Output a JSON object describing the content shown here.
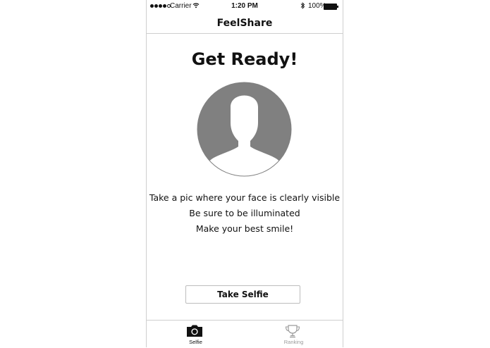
{
  "status_bar": {
    "carrier": "Carrier",
    "time": "1:20 PM",
    "battery": "100%",
    "wifi_icon": "wifi-icon",
    "bluetooth_icon": "bluetooth-icon"
  },
  "nav": {
    "title": "FeelShare"
  },
  "main": {
    "headline": "Get Ready!",
    "avatar_icon": "person-silhouette-icon",
    "instructions": [
      "Take  a pic  where your  face is clearly visible",
      "Be sure to be illuminated",
      "Make your best smile!"
    ],
    "take_selfie_label": "Take Selfie"
  },
  "tab_bar": {
    "tabs": [
      {
        "label": "Selfie",
        "icon": "camera-icon",
        "active": true
      },
      {
        "label": "Ranking",
        "icon": "trophy-icon",
        "active": false
      }
    ]
  },
  "colors": {
    "avatar_gray": "#808080",
    "border": "#cfcfcf",
    "inactive_tab": "#9a9a9a",
    "text": "#111111"
  }
}
